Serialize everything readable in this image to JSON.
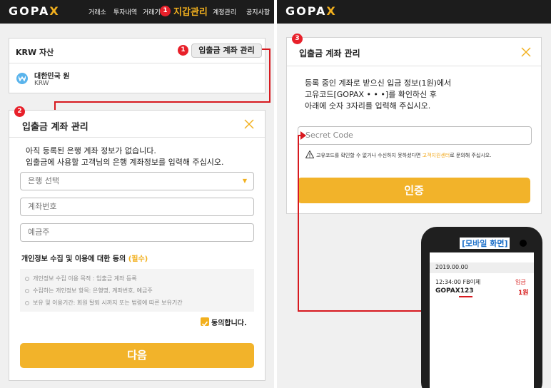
{
  "left": {
    "logo": "GOPA",
    "logo_x": "X",
    "nav": [
      "거래소",
      "투자내역",
      "거래기",
      "지갑관리",
      "계정관리",
      "공지사항"
    ],
    "badges": [
      "1",
      "1",
      "2"
    ],
    "asset_card": {
      "title": "KRW 자산",
      "manage_button": "입출금 계좌 관리",
      "currency_name": "대한민국 원",
      "currency_code": "KRW"
    },
    "modal": {
      "title": "입출금 계좌 관리",
      "line1": "아직 등록된 은행 계좌 정보가 없습니다.",
      "line2": "입출금에 사용할 고객님의 은행 계좌정보를 입력해 주십시오.",
      "bank_select": "은행 선택",
      "account_placeholder": "계좌번호",
      "holder_placeholder": "예금주",
      "consent_title": "개인정보 수집 및 이용에 대한 동의",
      "consent_required": "(필수)",
      "notices": [
        "개인정보 수집 이용 목적 : 입출금 계좌 등록",
        "수집하는 개인정보 항목: 은행명, 계좌번호, 예금주",
        "보유 및 이용기간: 회원 탈퇴 시까지 또는 법령에 따른 보유기간"
      ],
      "agree_label": "동의합니다.",
      "next_button": "다음"
    }
  },
  "right": {
    "logo": "GOPA",
    "logo_x": "X",
    "badge": "3",
    "modal": {
      "title": "입출금 계좌 관리",
      "line1": "등록 중인 계좌로 받으신 입금 정보(1원)에서",
      "line2": "고유코드[GOPAX • • •]를 확인하신 후",
      "line3": "아래에 숫자 3자리를 입력해 주십시오.",
      "code_placeholder": "Secret Code",
      "warning_prefix": "고유코드를 확인할 수 없거나 수신하지 못하셨다면",
      "warning_link": "고객지원센터",
      "warning_suffix": "로 문의해 주십시오.",
      "verify_button": "인증"
    },
    "phone": {
      "label": "[모바일 화면]",
      "date": "2019.00.00",
      "time_line": "12:34:00  FB이체",
      "deposit_label": "입금",
      "sender": "GOPAX123",
      "amount": "1원"
    }
  },
  "colors": {
    "accent": "#f2b01e",
    "button": "#f2b32a",
    "badge": "#e8202a",
    "topbar": "#1c1c1c",
    "link": "#f2a91e",
    "phone_label": "#1a6ec8",
    "deposit": "#d81e1e"
  },
  "icons": [
    "close-icon",
    "krw-currency-icon",
    "dropdown-arrow-icon",
    "checkbox-checked-icon",
    "warning-icon",
    "camera-icon"
  ]
}
